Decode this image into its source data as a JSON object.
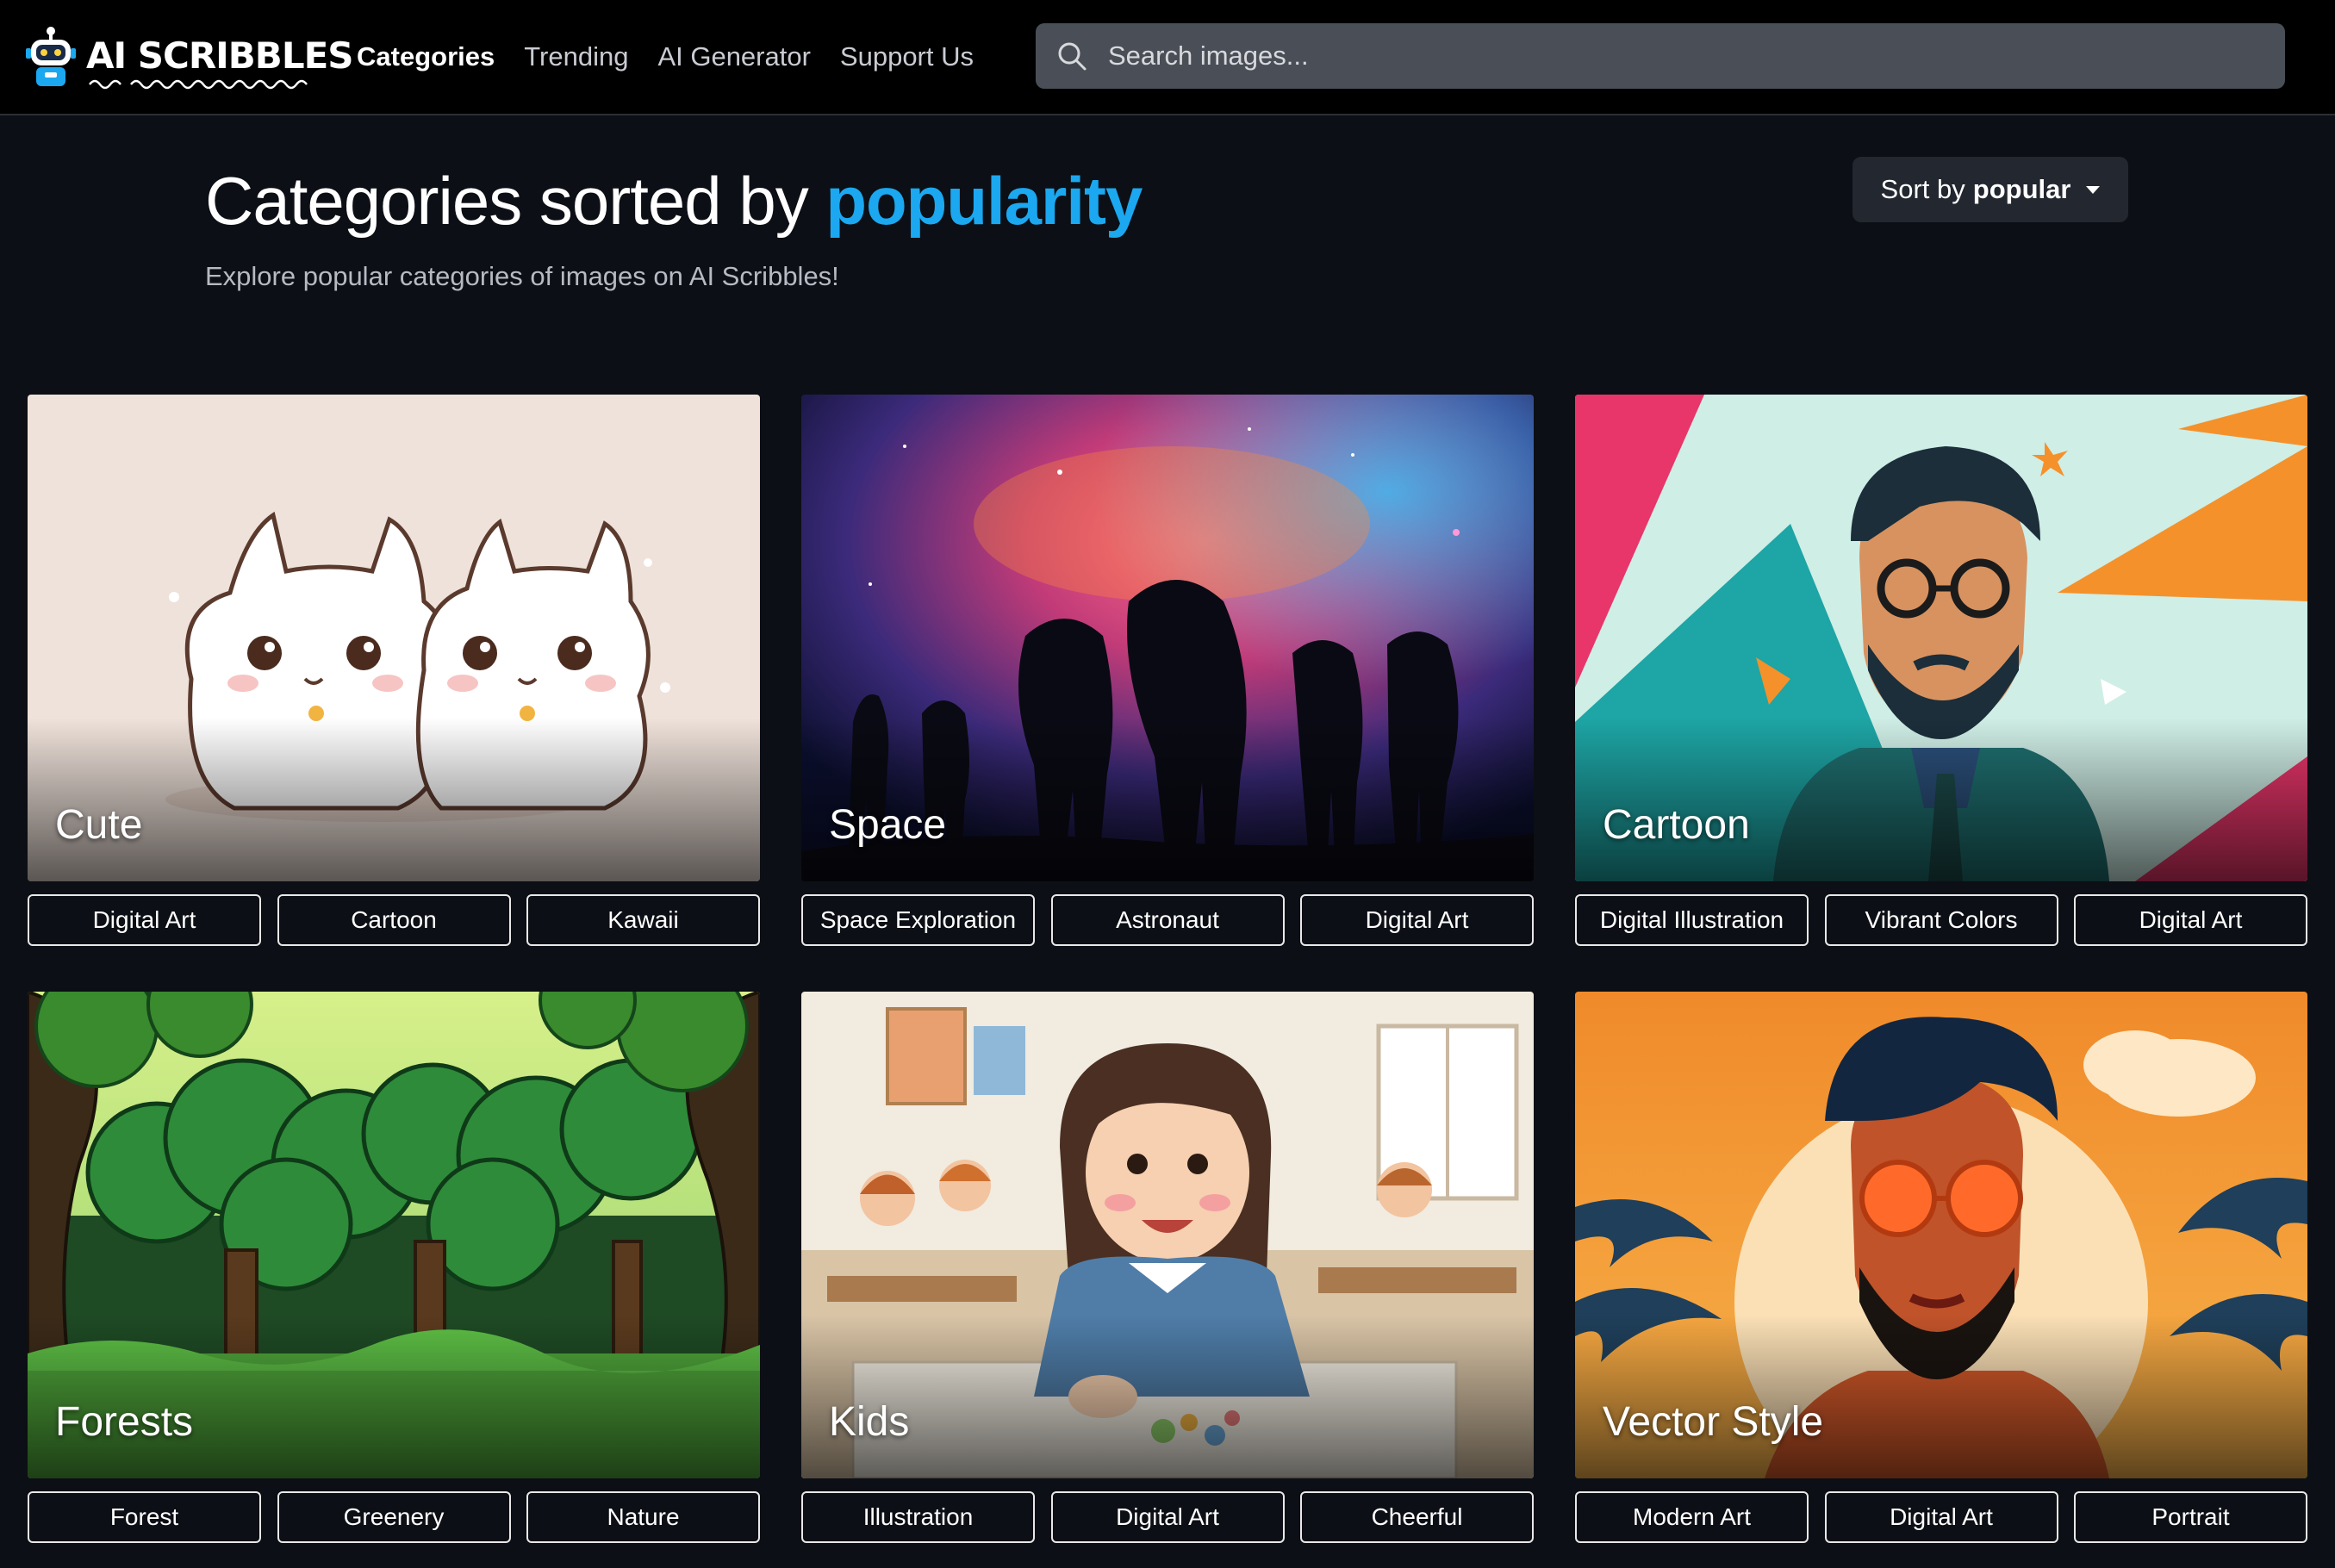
{
  "brand": {
    "name": "AI SCRIBBLES"
  },
  "nav": {
    "items": [
      "Categories",
      "Trending",
      "AI Generator",
      "Support Us"
    ],
    "active": "Categories"
  },
  "search": {
    "placeholder": "Search images...",
    "value": ""
  },
  "page": {
    "title_prefix": "Categories sorted by",
    "title_accent": "popularity",
    "subtitle": "Explore popular categories of images on AI Scribbles!"
  },
  "sort": {
    "prefix": "Sort by",
    "value": "popular"
  },
  "colors": {
    "accent": "#1ba8f0",
    "background": "#0c0f15",
    "topbar": "#000000",
    "search_bg": "#4a4f57"
  },
  "categories": [
    {
      "title": "Cute",
      "tags": [
        "Digital Art",
        "Cartoon",
        "Kawaii"
      ]
    },
    {
      "title": "Space",
      "tags": [
        "Space Exploration",
        "Astronaut",
        "Digital Art"
      ]
    },
    {
      "title": "Cartoon",
      "tags": [
        "Digital Illustration",
        "Vibrant Colors",
        "Digital Art"
      ]
    },
    {
      "title": "Forests",
      "tags": [
        "Forest",
        "Greenery",
        "Nature"
      ]
    },
    {
      "title": "Kids",
      "tags": [
        "Illustration",
        "Digital Art",
        "Cheerful"
      ]
    },
    {
      "title": "Vector Style",
      "tags": [
        "Modern Art",
        "Digital Art",
        "Portrait"
      ]
    }
  ],
  "icons": {
    "search": "search-icon",
    "sort_caret": "chevron-down-icon",
    "logo": "robot-logo-icon"
  }
}
